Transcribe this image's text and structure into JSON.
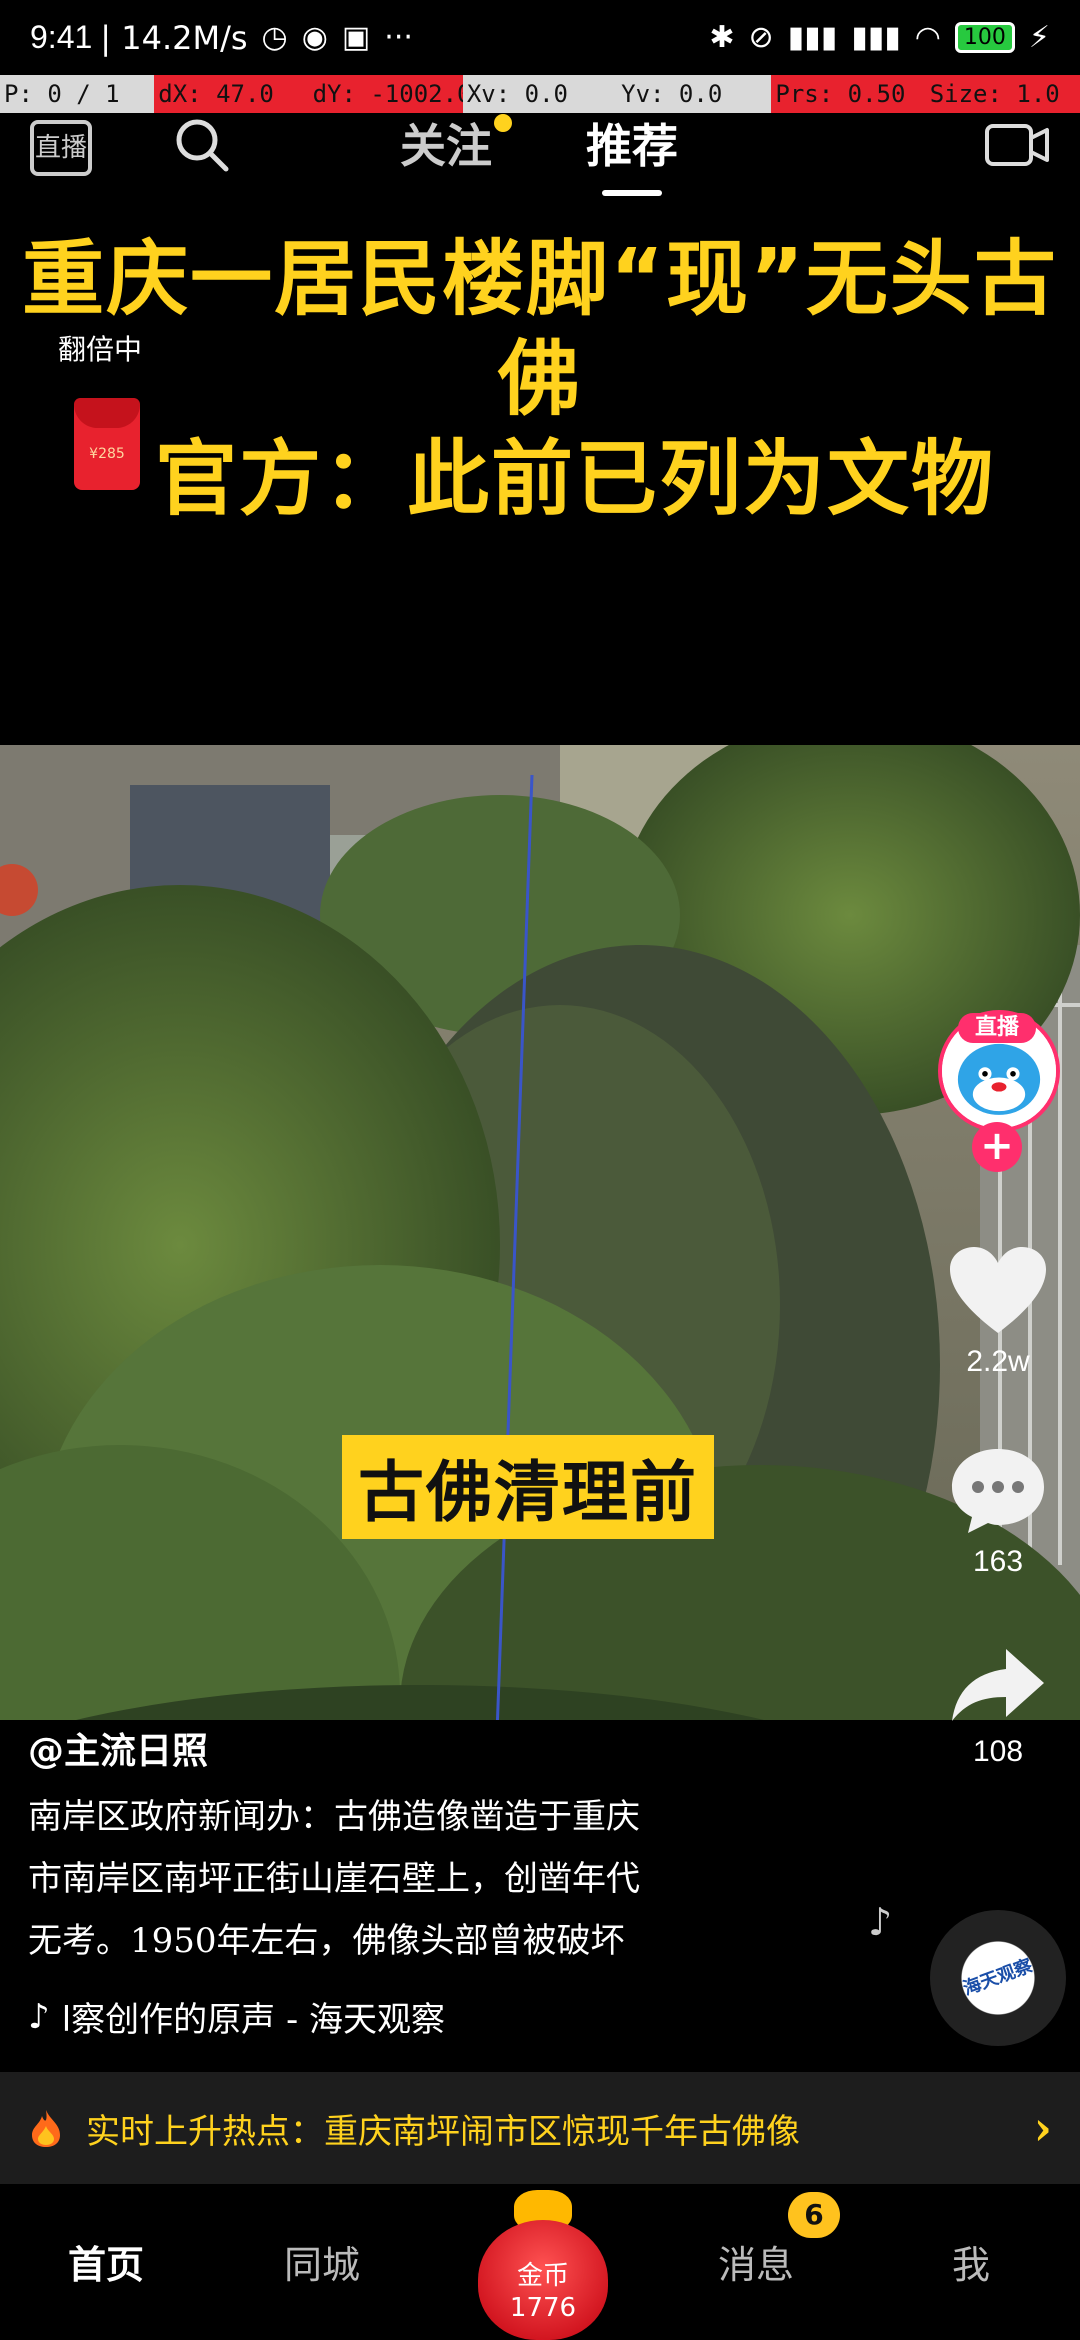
{
  "status_bar": {
    "time": "9:41",
    "speed": "| 14.2M/s",
    "battery": "100"
  },
  "debug_bar": [
    "P: 0 / 1",
    "dX: 47.0",
    "dY: -1002.0",
    "Xv: 0.0",
    "Yv: 0.0",
    "Prs: 0.50",
    "Size: 1.0"
  ],
  "top_nav": {
    "live_label": "直播",
    "tab_follow": "关注",
    "tab_recommend": "推荐"
  },
  "video": {
    "headline_line1": "重庆一居民楼脚“现”无头古佛",
    "headline_line2": "官方：此前已列为文物",
    "caption_tag": "古佛清理前"
  },
  "red_packet": {
    "label": "翻倍中",
    "amount": "¥285"
  },
  "right_rail": {
    "live_badge": "直播",
    "follow_plus": "+",
    "likes": "2.2w",
    "comments": "163",
    "shares": "108"
  },
  "post": {
    "author": "@主流日照",
    "description_lines": [
      "南岸区政府新闻办：古佛造像凿造于重庆",
      "市南岸区南坪正街山崖石壁上，创凿年代",
      "无考。1950年左右，佛像头部曾被破坏"
    ],
    "music": "l察创作的原声 - 海天观察",
    "disc_label": "海天观察"
  },
  "hot_bar": {
    "text": "实时上升热点：重庆南坪闹市区惊现千年古佛像"
  },
  "tab_bar": {
    "home": "首页",
    "nearby": "同城",
    "coin_label": "金币",
    "coin_value": "1776",
    "messages": "消息",
    "messages_badge": "6",
    "me": "我"
  },
  "colors": {
    "headline_yellow": "#ffd21e",
    "accent_pink": "#ff2f6d",
    "debug_red": "#e8222e"
  }
}
